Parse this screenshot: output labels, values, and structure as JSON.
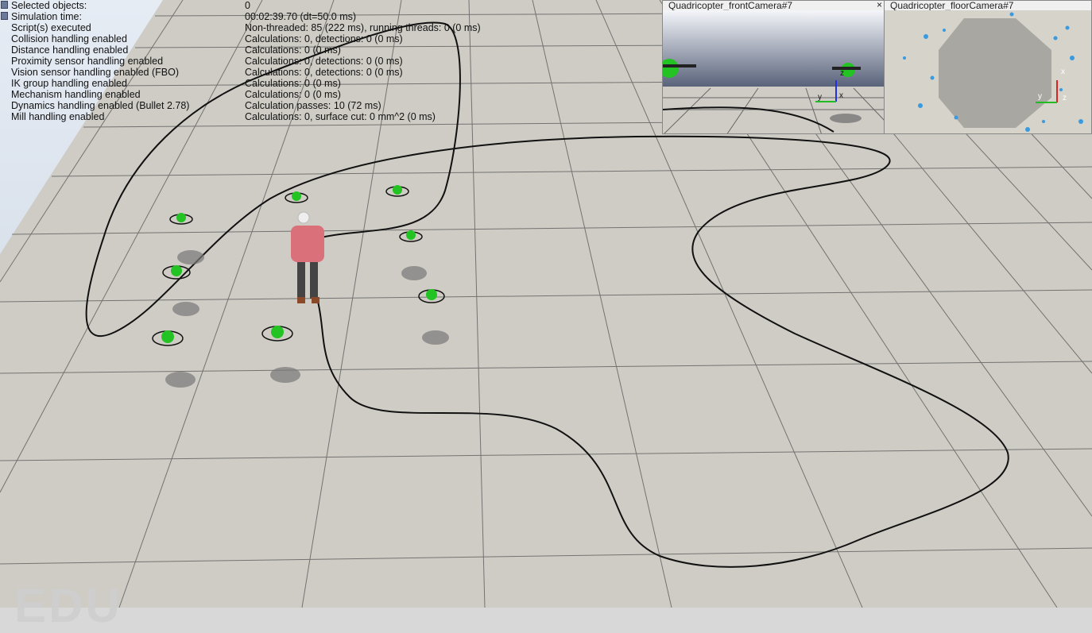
{
  "info_panel": {
    "rows": [
      {
        "label": "Selected objects:",
        "value": "0"
      },
      {
        "label": "Simulation time:",
        "value": "00:02:39.70 (dt=50.0 ms)"
      },
      {
        "label": "Script(s) executed",
        "value": "Non-threaded: 85 (222 ms), running threads: 0 (0 ms)"
      },
      {
        "label": "Collision handling enabled",
        "value": "Calculations: 0, detections: 0 (0 ms)"
      },
      {
        "label": "Distance handling enabled",
        "value": "Calculations: 0 (0 ms)"
      },
      {
        "label": "Proximity sensor handling enabled",
        "value": "Calculations: 0, detections: 0 (0 ms)"
      },
      {
        "label": "Vision sensor handling enabled (FBO)",
        "value": "Calculations: 0, detections: 0 (0 ms)"
      },
      {
        "label": "IK group handling enabled",
        "value": "Calculations: 0 (0 ms)"
      },
      {
        "label": "Mechanism handling enabled",
        "value": "Calculations: 0 (0 ms)"
      },
      {
        "label": "Dynamics handling enabled (Bullet 2.78)",
        "value": "Calculation passes: 10 (72 ms)"
      },
      {
        "label": "Mill handling enabled",
        "value": "Calculations: 0, surface cut: 0 mm^2 (0 ms)"
      }
    ]
  },
  "cameras": {
    "front": {
      "title": "Quadricopter_frontCamera#7",
      "close": "×"
    },
    "floor": {
      "title": "Quadricopter_floorCamera#7"
    }
  },
  "axes": {
    "x": "x",
    "y": "y",
    "z": "z"
  },
  "watermark": "EDU",
  "colors": {
    "floor": "#cfccc5",
    "grid": "#5a5a5a",
    "path": "#111111",
    "drone": "#22c322",
    "shirt": "#d9707a"
  },
  "icons": [
    "quadricopter-icon",
    "person-icon",
    "axis-gizmo-icon"
  ]
}
